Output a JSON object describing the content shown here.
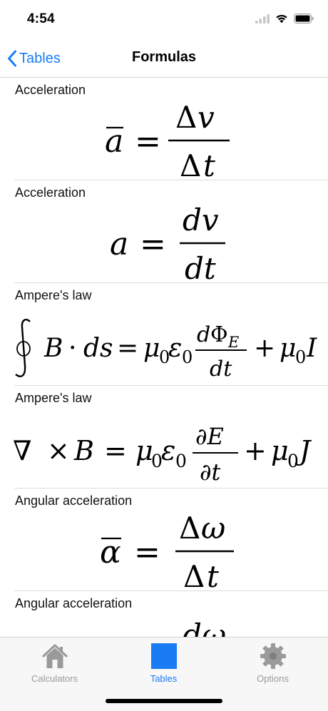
{
  "status_bar": {
    "time": "4:54"
  },
  "nav": {
    "back_label": "Tables",
    "title": "Formulas"
  },
  "formulas": [
    {
      "name": "Acceleration"
    },
    {
      "name": "Acceleration"
    },
    {
      "name": "Ampere's law"
    },
    {
      "name": "Ampere's law"
    },
    {
      "name": "Angular acceleration"
    },
    {
      "name": "Angular acceleration"
    }
  ],
  "tab_bar": {
    "items": [
      {
        "label": "Calculators",
        "icon": "house-icon",
        "active": false
      },
      {
        "label": "Tables",
        "icon": "square-icon",
        "active": true
      },
      {
        "label": "Options",
        "icon": "gear-icon",
        "active": false
      }
    ],
    "active_color": "#1a7cf5",
    "inactive_color": "#9a9a9a"
  },
  "colors": {
    "accent": "#1a7cf5"
  }
}
